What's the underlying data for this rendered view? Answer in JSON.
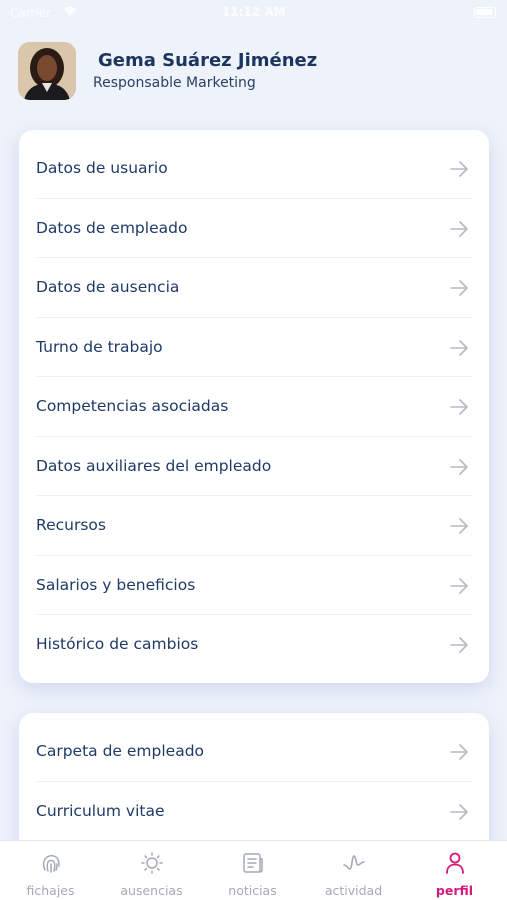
{
  "status_bar": {
    "carrier": "Carrier",
    "time": "11:12 AM"
  },
  "profile": {
    "name": "Gema Suárez Jiménez",
    "role": "Responsable Marketing"
  },
  "menu_group_1": [
    {
      "label": "Datos de usuario"
    },
    {
      "label": "Datos de empleado"
    },
    {
      "label": "Datos de ausencia"
    },
    {
      "label": "Turno de trabajo"
    },
    {
      "label": "Competencias asociadas"
    },
    {
      "label": "Datos auxiliares del empleado"
    },
    {
      "label": "Recursos"
    },
    {
      "label": "Salarios y beneficios"
    },
    {
      "label": "Histórico de cambios"
    }
  ],
  "menu_group_2": [
    {
      "label": "Carpeta de empleado"
    },
    {
      "label": "Curriculum vitae"
    },
    {
      "label": ""
    }
  ],
  "tab_bar": {
    "tabs": [
      {
        "label": "fichajes",
        "icon": "fingerprint-icon"
      },
      {
        "label": "ausencias",
        "icon": "sun-icon"
      },
      {
        "label": "noticias",
        "icon": "newspaper-icon"
      },
      {
        "label": "actividad",
        "icon": "activity-wave-icon"
      },
      {
        "label": "perfil",
        "icon": "user-icon"
      }
    ],
    "active": "perfil"
  },
  "colors": {
    "background": "#eef2fb",
    "text_primary": "#1f3a66",
    "accent": "#d6197a",
    "tab_inactive": "#a3aab7"
  }
}
